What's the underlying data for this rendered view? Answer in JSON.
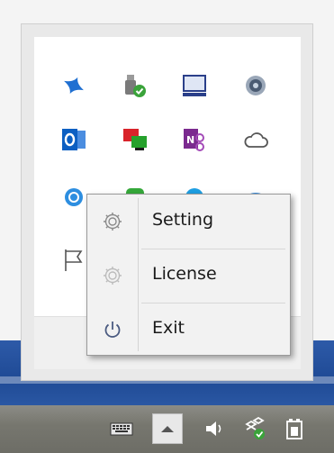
{
  "tray_icons": [
    {
      "name": "splashtop-icon"
    },
    {
      "name": "usb-safe-remove-icon"
    },
    {
      "name": "display-icon"
    },
    {
      "name": "disc-icon"
    },
    {
      "name": "outlook-icon"
    },
    {
      "name": "network-monitor-icon"
    },
    {
      "name": "onenote-icon"
    },
    {
      "name": "cloud-icon"
    },
    {
      "name": "blue-app-icon"
    },
    {
      "name": "green-app-icon"
    },
    {
      "name": "skype-icon"
    },
    {
      "name": "blue-cloud-icon"
    },
    {
      "name": "flag-icon"
    }
  ],
  "context_menu": {
    "items": [
      {
        "label": "Setting",
        "icon": "gear-icon"
      },
      {
        "label": "License",
        "icon": "gear-faded-icon"
      },
      {
        "label": "Exit",
        "icon": "power-icon"
      }
    ]
  },
  "taskbar": {
    "icons": [
      "keyboard-icon",
      "show-hidden-icons-chevron",
      "speaker-icon",
      "network-status-icon",
      "battery-icon"
    ]
  },
  "colors": {
    "desktop_blue": "#1f4a95",
    "menu_bg": "#f2f2f2",
    "taskbar": "#77776f"
  }
}
